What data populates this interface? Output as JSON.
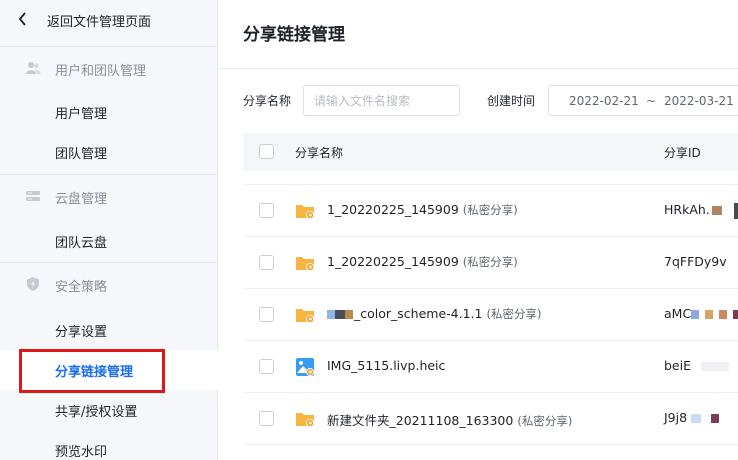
{
  "sidebar": {
    "back_label": "返回文件管理页面",
    "groups": [
      {
        "label": "用户和团队管理",
        "items": [
          {
            "label": "用户管理"
          },
          {
            "label": "团队管理"
          }
        ]
      },
      {
        "label": "云盘管理",
        "items": [
          {
            "label": "团队云盘"
          }
        ]
      },
      {
        "label": "安全策略",
        "items": [
          {
            "label": "分享设置"
          },
          {
            "label": "分享链接管理"
          },
          {
            "label": "共享/授权设置"
          },
          {
            "label": "预览水印"
          }
        ]
      }
    ]
  },
  "main": {
    "title": "分享链接管理",
    "filters": {
      "name_label": "分享名称",
      "name_placeholder": "请输入文件名搜索",
      "time_label": "创建时间",
      "date_start": "2022-02-21",
      "date_sep": "~",
      "date_end": "2022-03-21"
    },
    "table": {
      "columns": [
        "分享名称",
        "分享ID"
      ],
      "rows": [
        {
          "name": "1_20220225_145909",
          "tag": "(私密分享)",
          "id": "HRkAh.",
          "icon": "folder-icon"
        },
        {
          "name": "1_20220225_145909",
          "tag": "(私密分享)",
          "id": "7qFFDy9v",
          "icon": "folder-icon"
        },
        {
          "name": "_color_scheme-4.1.1",
          "tag": "(私密分享)",
          "id": "aMC",
          "icon": "folder-icon"
        },
        {
          "name": "IMG_5115.livp.heic",
          "tag": "",
          "id": "beiE",
          "icon": "image-file-icon"
        },
        {
          "name": "新建文件夹_20211108_163300",
          "tag": "(私密分享)",
          "id": "J9j8",
          "icon": "folder-icon"
        }
      ]
    }
  },
  "colors": {
    "accent": "#1a6cf0",
    "highlight_box": "#e01717",
    "folder": "#f7b541",
    "share_badge": "#f0a33b"
  }
}
